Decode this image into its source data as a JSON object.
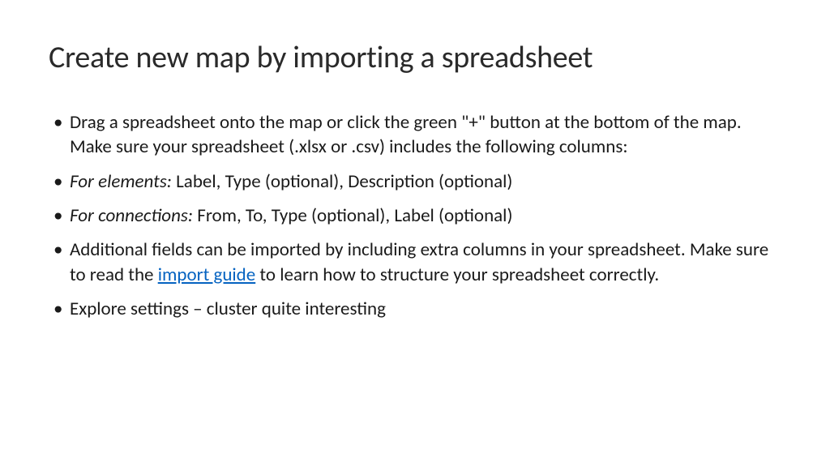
{
  "slide": {
    "title": "Create new map by importing a spreadsheet",
    "bullets": [
      {
        "text": "Drag a spreadsheet onto the map or click the green \"+\" button at the bottom of the map. Make sure your spreadsheet (.xlsx or .csv) includes the following columns:"
      },
      {
        "prefix_italic": "For elements: ",
        "rest": "Label, Type (optional), Description (optional)"
      },
      {
        "prefix_italic": "For connections: ",
        "rest": "From, To, Type (optional), Label (optional)"
      },
      {
        "pre_link": "Additional fields can be imported by including extra columns in your spreadsheet. Make sure to read the ",
        "link_text": "import guide",
        "post_link": " to learn how to structure your spreadsheet correctly."
      },
      {
        "text": "Explore settings – cluster quite interesting"
      }
    ]
  }
}
